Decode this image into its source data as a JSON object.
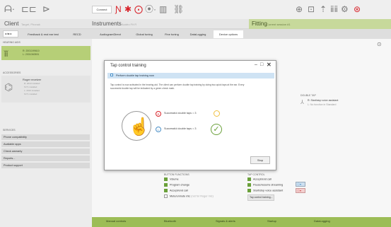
{
  "header": {
    "client_label": "Client",
    "client_name": "Target, Phonak",
    "instruments_label": "Instruments",
    "instruments_name": "Audéo Fit R",
    "fitting_label": "Fitting",
    "fitting_name": "Current session #1",
    "connect_label": "Connect"
  },
  "nav": {
    "tabs": [
      {
        "label": "Feedback & real ear test"
      },
      {
        "label": "RECD"
      },
      {
        "label": "AudiogramDirect"
      },
      {
        "label": "Global tuning"
      },
      {
        "label": "Fine tuning"
      },
      {
        "label": "DataLogging"
      },
      {
        "label": "Device options"
      }
    ]
  },
  "sidebar": {
    "hearing_aids_label": "HEARING AIDS",
    "hearing_aids_line1": "R: 2001199610",
    "hearing_aids_line2": "L: 2001060591",
    "accessories_label": "ACCESSORIES",
    "accessories_title": "Roger receiver",
    "accessories_lines": [
      "R: 2010 installed",
      "S/Y1 installed",
      "L: 2010 installed",
      "S/Y1 installed"
    ],
    "services_label": "SERVICES",
    "services": [
      {
        "label": "Phone compatibility"
      },
      {
        "label": "Available apps"
      },
      {
        "label": "Check warranty"
      },
      {
        "label": "Reports..."
      },
      {
        "label": "Product support"
      }
    ]
  },
  "main": {
    "double_tap_label": "DOUBLE TAP",
    "double_tap_r": "R: Start/stop voice assistant",
    "double_tap_l": "L: No function in Standard",
    "button_functions_label": "BUTTON FUNCTIONS",
    "button_functions": [
      {
        "label": "Volume",
        "checked": true
      },
      {
        "label": "Program change",
        "checked": true
      },
      {
        "label": "Accept/end call",
        "checked": true
      },
      {
        "label": "Mute/unmute mic",
        "checked": false,
        "note": "(not for Roger mic)"
      }
    ],
    "tap_control_label": "TAP CONTROL",
    "tap_control": [
      {
        "label": "Accept/end call",
        "checked": true
      },
      {
        "label": "Pause/resume streaming",
        "checked": true
      },
      {
        "label": "Start/stop voice assistant",
        "checked": true
      }
    ],
    "tap_training_button": "Tap control training..."
  },
  "dialog": {
    "title": "Tap control training",
    "banner": "Perform double tap training now",
    "body": "Tap control is now activated in the hearing aid. The client can perform double tap training by doing two quick taps at the ear. Every successful double tap will be indicated by a green check mark.",
    "status_r": "Successful double taps = 3",
    "status_l": "Successful double taps = 3",
    "stop_label": "Stop",
    "r_badge": "R",
    "l_badge": "L"
  },
  "bottom": {
    "tabs": [
      {
        "label": "Manual controls"
      },
      {
        "label": "Bluetooth"
      },
      {
        "label": "Signals & alerts"
      },
      {
        "label": "Startup"
      },
      {
        "label": "DataLogging"
      }
    ]
  },
  "colors": {
    "accent_green": "#9cbd56",
    "check_green": "#6aa03a",
    "red_icon": "#d8232a",
    "blue_badge": "#4a90c8"
  }
}
